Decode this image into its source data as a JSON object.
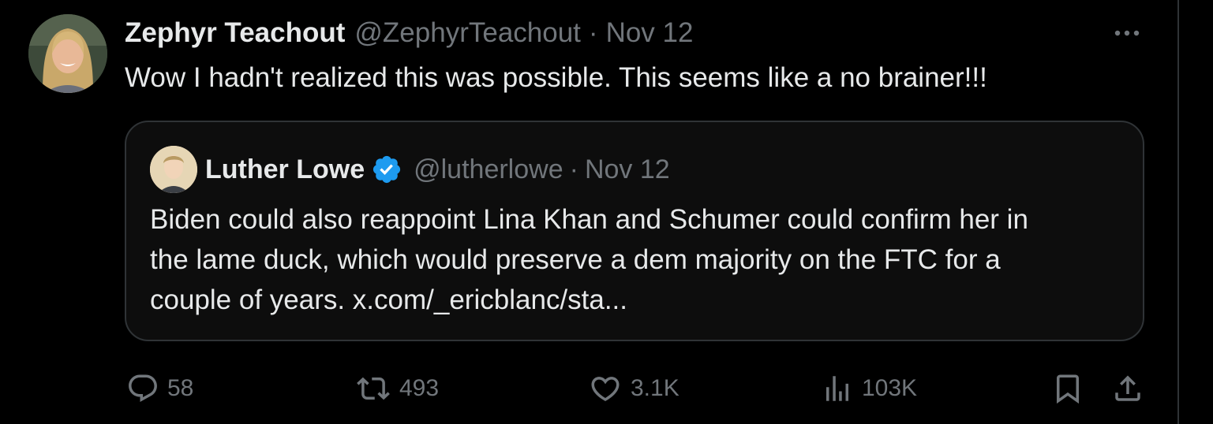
{
  "author": {
    "name": "Zephyr Teachout",
    "handle": "@ZephyrTeachout",
    "separator": "·",
    "date": "Nov 12"
  },
  "tweet_text": "Wow I hadn't realized this was possible. This seems like a no brainer!!!",
  "quoted": {
    "name": "Luther Lowe",
    "handle": "@lutherlowe",
    "separator": "·",
    "date": "Nov 12",
    "lines": [
      "Biden could also reappoint Lina Khan and Schumer could confirm her in",
      "the lame duck, which would preserve a dem majority on the FTC for a",
      "couple of years. x.com/_ericblanc/sta..."
    ]
  },
  "actions": {
    "replies": "58",
    "reposts": "493",
    "likes": "3.1K",
    "views": "103K"
  },
  "icons": {
    "more": "more-horizontal-icon",
    "verified": "verified-badge-icon",
    "reply": "reply-icon",
    "repost": "repost-icon",
    "like": "heart-icon",
    "views": "views-icon",
    "bookmark": "bookmark-icon",
    "share": "share-icon"
  },
  "colors": {
    "background": "#000000",
    "text": "#e7e9ea",
    "secondary": "#71767b",
    "border": "#2f3336",
    "verified": "#1d9bf0"
  }
}
